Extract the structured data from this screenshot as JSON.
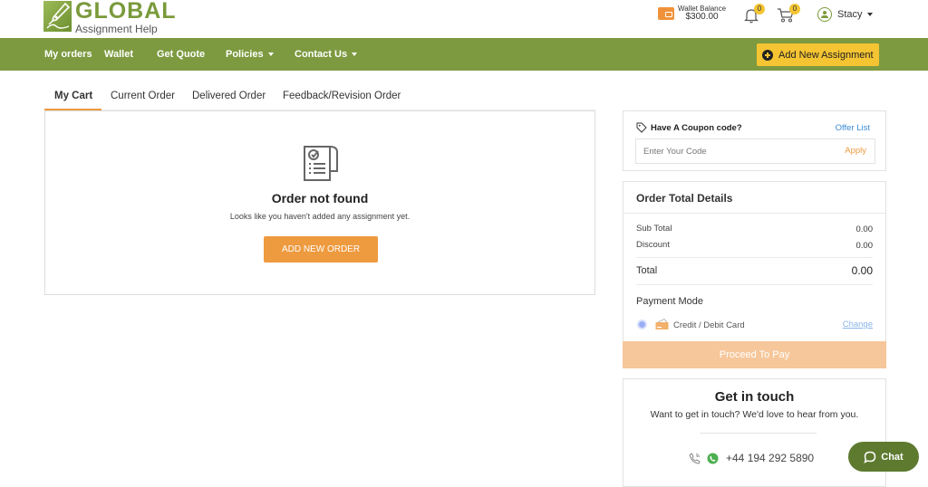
{
  "brand": {
    "title": "GLOBAL",
    "subtitle": "Assignment Help"
  },
  "header": {
    "wallet_label": "Wallet Balance",
    "wallet_amount": "$300.00",
    "notifications_count": "0",
    "cart_count": "0",
    "user_name": "Stacy"
  },
  "nav": {
    "items": [
      {
        "label": "My orders"
      },
      {
        "label": "Wallet"
      },
      {
        "label": "Get Quote"
      },
      {
        "label": "Policies",
        "dropdown": true
      },
      {
        "label": "Contact Us",
        "dropdown": true
      }
    ],
    "add_assignment_label": "Add New Assignment"
  },
  "tabs": [
    {
      "label": "My Cart",
      "active": true
    },
    {
      "label": "Current Order"
    },
    {
      "label": "Delivered Order"
    },
    {
      "label": "Feedback/Revision Order"
    }
  ],
  "cart": {
    "empty_title": "Order not found",
    "empty_subtitle": "Looks like you haven't added any assignment yet.",
    "add_order_label": "ADD NEW ORDER"
  },
  "coupon": {
    "heading": "Have A Coupon code?",
    "offer_list_label": "Offer List",
    "input_placeholder": "Enter Your Code",
    "apply_label": "Apply"
  },
  "totals": {
    "title": "Order Total Details",
    "sub_total_label": "Sub Total",
    "sub_total_value": "0.00",
    "discount_label": "Discount",
    "discount_value": "0.00",
    "total_label": "Total",
    "total_value": "0.00",
    "payment_mode_label": "Payment Mode",
    "payment_method": "Credit / Debit Card",
    "change_label": "Change",
    "proceed_label": "Proceed To Pay"
  },
  "contact": {
    "title": "Get in touch",
    "subtitle": "Want to get in touch? We'd love to hear from you.",
    "phone": "+44 194 292 5890"
  },
  "chat": {
    "label": "Chat"
  },
  "colors": {
    "brand_green": "#7d9a40",
    "accent_orange": "#ee9a3f",
    "accent_yellow": "#f4c432",
    "link_blue": "#3a8ed8",
    "chat_green": "#5e7a2f"
  }
}
